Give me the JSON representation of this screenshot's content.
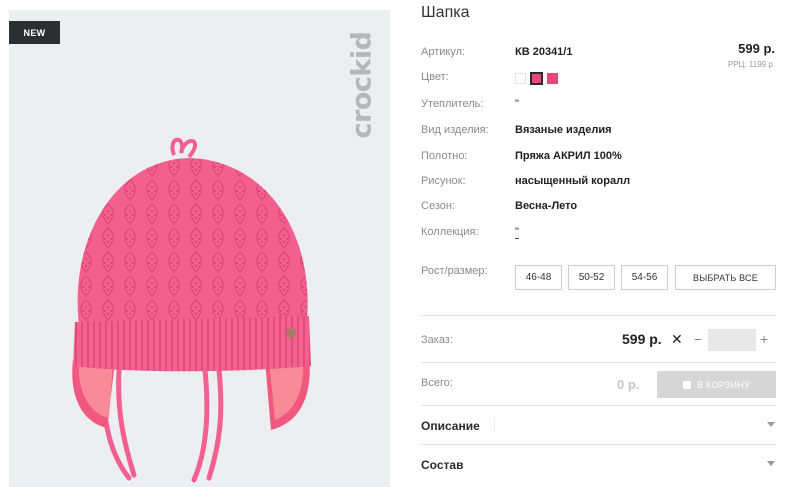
{
  "badge": {
    "new": "NEW"
  },
  "brand": {
    "vertical_logo": "crockid"
  },
  "product": {
    "title": "Шапка",
    "price": "599 р.",
    "rrp": "РРЦ: 1199 р.",
    "specs": [
      {
        "label": "Артикул:",
        "value": "КВ 20341/1"
      },
      {
        "label": "Цвет:",
        "value": ""
      },
      {
        "label": "Утеплитель:",
        "value": "\""
      },
      {
        "label": "Вид изделия:",
        "value": "Вязаные изделия"
      },
      {
        "label": "Полотно:",
        "value": "Пряжа АКРИЛ 100%"
      },
      {
        "label": "Рисунок:",
        "value": "насыщенный коралл"
      },
      {
        "label": "Сезон:",
        "value": "Весна-Лето"
      },
      {
        "label": "Коллекция:",
        "value": "\""
      }
    ],
    "colors": [
      "#ffffff",
      "#e8457a",
      "#e8457a"
    ]
  },
  "sizes": {
    "label": "Рост/размер:",
    "options": [
      "46-48",
      "50-52",
      "54-56"
    ],
    "select_all": "ВЫБРАТЬ ВСЕ"
  },
  "order": {
    "label": "Заказ:",
    "price": "599 р.",
    "times": "✕",
    "minus": "−",
    "plus": "+",
    "qty_value": ""
  },
  "total": {
    "label": "Всего:",
    "value": "0 р.",
    "cart_button": "В КОРЗИНУ"
  },
  "sections": {
    "description": "Описание",
    "composition": "Состав"
  },
  "colors": {
    "product_pink": "#f2608f",
    "badge_bg": "#2c2f31",
    "image_bg": "#eceeef"
  }
}
